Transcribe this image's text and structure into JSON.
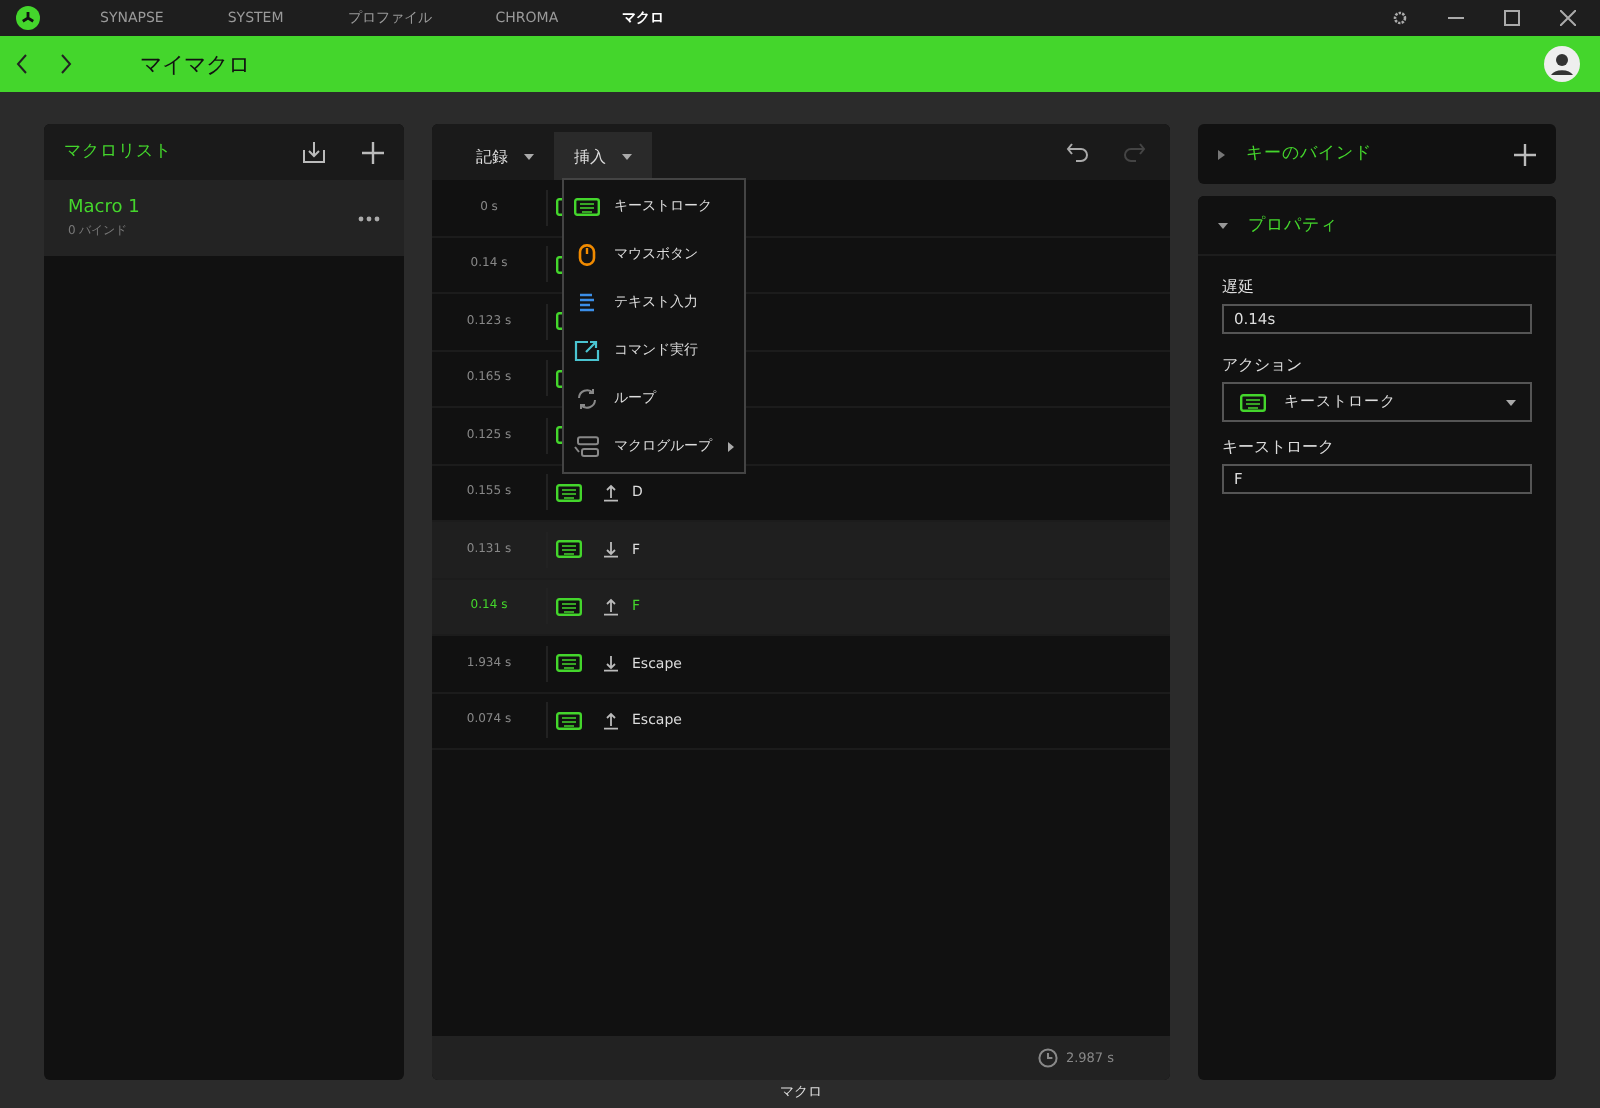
{
  "nav": {
    "tabs": [
      {
        "label": "SYNAPSE",
        "selected": false
      },
      {
        "label": "SYSTEM",
        "selected": false
      },
      {
        "label": "プロファイル",
        "selected": false
      },
      {
        "label": "CHROMA",
        "selected": false
      },
      {
        "label": "マクロ",
        "selected": true
      }
    ]
  },
  "header": {
    "title": "マイマクロ"
  },
  "macro_list": {
    "title": "マクロリスト",
    "items": [
      {
        "name": "Macro 1",
        "sub": "0 バインド",
        "selected": true
      }
    ]
  },
  "editor": {
    "toolbar": [
      {
        "label": "記録",
        "selected": false
      },
      {
        "label": "挿入",
        "selected": true
      }
    ],
    "rows": [
      {
        "delay": "0 s",
        "highlighted": false,
        "selected": false
      },
      {
        "delay": "0.14 s",
        "highlighted": false,
        "selected": false
      },
      {
        "delay": "0.123 s",
        "highlighted": false,
        "selected": false
      },
      {
        "delay": "0.165 s",
        "highlighted": false,
        "selected": false
      },
      {
        "delay": "0.125 s",
        "highlighted": false,
        "selected": false
      },
      {
        "delay": "0.155 s",
        "released": true,
        "key": "D",
        "highlighted": false,
        "selected": false
      },
      {
        "delay": "0.131 s",
        "released": false,
        "key": "F",
        "highlighted": true,
        "selected": false
      },
      {
        "delay": "0.14 s",
        "released": true,
        "key": "F",
        "highlighted": true,
        "selected": true
      },
      {
        "delay": "1.934 s",
        "released": false,
        "key": "Escape",
        "highlighted": false,
        "selected": false
      },
      {
        "delay": "0.074 s",
        "released": true,
        "key": "Escape",
        "highlighted": false,
        "selected": false
      }
    ],
    "total": "2.987 s"
  },
  "insert_menu": [
    {
      "kind": "keystroke",
      "label": "キーストローク"
    },
    {
      "kind": "mouse",
      "label": "マウスボタン"
    },
    {
      "kind": "text",
      "label": "テキスト入力"
    },
    {
      "kind": "command",
      "label": "コマンド実行"
    },
    {
      "kind": "loop",
      "label": "ループ"
    },
    {
      "kind": "group",
      "label": "マクログループ",
      "submenu": true
    }
  ],
  "key_bind": {
    "title": "キーのバインド",
    "expanded": false
  },
  "properties": {
    "title": "プロパティ",
    "expanded": true,
    "delay_label": "遅延",
    "delay": "0.14s",
    "action_label": "アクション",
    "action": "キーストローク",
    "key_label": "キーストローク",
    "key": "F"
  },
  "footer": {
    "label": "マクロ"
  }
}
